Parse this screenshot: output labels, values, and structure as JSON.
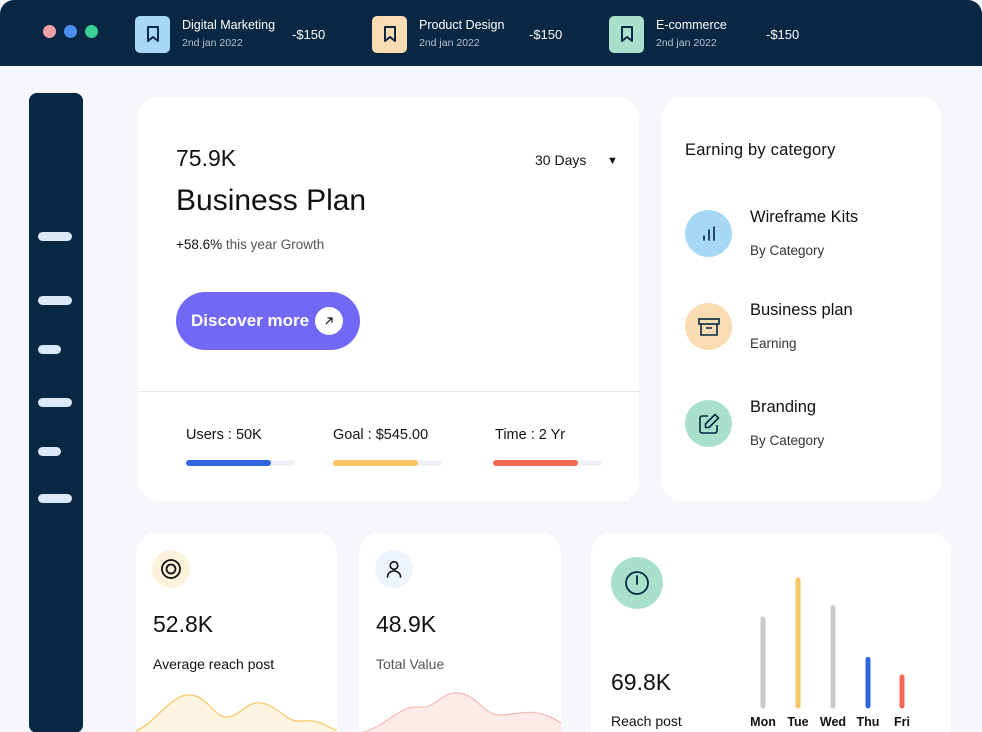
{
  "window": {
    "dots": [
      {
        "name": "close",
        "color": "#f3a0a4"
      },
      {
        "name": "minimize",
        "color": "#4a8ef0"
      },
      {
        "name": "maximize",
        "color": "#3ccd96"
      }
    ]
  },
  "transactions": [
    {
      "title": "Digital Marketing",
      "date": "2nd jan 2022",
      "amount": "-$150",
      "icon": "bookmark-icon",
      "color": "#a6d7f5"
    },
    {
      "title": "Product Design",
      "date": "2nd jan 2022",
      "amount": "-$150",
      "icon": "bookmark-icon",
      "color": "#f9dcb1"
    },
    {
      "title": "E-commerce",
      "date": "2nd jan 2022",
      "amount": "-$150",
      "icon": "bookmark-icon",
      "color": "#a9e0cb"
    }
  ],
  "business": {
    "value": "75.9K",
    "period": "30 Days",
    "title": "Business Plan",
    "growth_percent": "+58.6%",
    "growth_text": " this year Growth",
    "button_label": "Discover more",
    "stats": [
      {
        "label": "Users : 50K",
        "progress": 0.78,
        "color": "#2f66e0"
      },
      {
        "label": "Goal : $545.00",
        "progress": 0.78,
        "color": "#f8c664"
      },
      {
        "label": "Time : 2 Yr",
        "progress": 0.78,
        "color": "#f26a56"
      }
    ]
  },
  "categories": {
    "title": "Earning by category",
    "items": [
      {
        "name": "Wireframe Kits",
        "sub": "By Category",
        "icon": "bar-chart-icon",
        "color": "#a6d7f5"
      },
      {
        "name": "Business plan",
        "sub": "Earning",
        "icon": "archive-box-icon",
        "color": "#f9dcb1"
      },
      {
        "name": "Branding",
        "sub": "By Category",
        "icon": "edit-icon",
        "color": "#a9e0cb"
      }
    ]
  },
  "summary": [
    {
      "value": "52.8K",
      "label": "Average reach post",
      "icon": "target-icon",
      "icon_bg": "#fcf2dc"
    },
    {
      "value": "48.9K",
      "label": "Total Value",
      "icon": "user-icon",
      "icon_bg": "#eef4fc"
    }
  ],
  "reach": {
    "value": "69.8K",
    "label": "Reach post",
    "icon": "power-icon",
    "chart_data": {
      "type": "bar",
      "categories": [
        "Mon",
        "Tue",
        "Wed",
        "Thu",
        "Fri"
      ],
      "values": [
        0.69,
        1.0,
        0.78,
        0.37,
        0.23
      ],
      "colors": [
        "#c9c9c9",
        "#f8c664",
        "#c9c9c9",
        "#2f66e0",
        "#f26a56"
      ]
    }
  }
}
